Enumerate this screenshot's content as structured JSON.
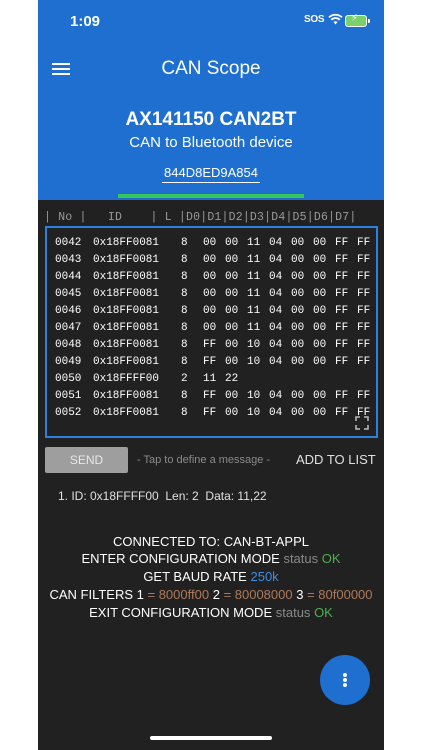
{
  "status_bar": {
    "time": "1:09",
    "sos": "SOS"
  },
  "app_bar": {
    "title": "CAN Scope"
  },
  "device": {
    "name": "AX141150 CAN2BT",
    "subtitle": "CAN to Bluetooth device",
    "mac": "844D8ED9A854"
  },
  "table": {
    "header": "| No |   ID    | L |D0|D1|D2|D3|D4|D5|D6|D7|",
    "rows": [
      {
        "no": "0042",
        "id": "0x18FF0081",
        "len": "8",
        "data": [
          "00",
          "00",
          "11",
          "04",
          "00",
          "00",
          "FF",
          "FF"
        ]
      },
      {
        "no": "0043",
        "id": "0x18FF0081",
        "len": "8",
        "data": [
          "00",
          "00",
          "11",
          "04",
          "00",
          "00",
          "FF",
          "FF"
        ]
      },
      {
        "no": "0044",
        "id": "0x18FF0081",
        "len": "8",
        "data": [
          "00",
          "00",
          "11",
          "04",
          "00",
          "00",
          "FF",
          "FF"
        ]
      },
      {
        "no": "0045",
        "id": "0x18FF0081",
        "len": "8",
        "data": [
          "00",
          "00",
          "11",
          "04",
          "00",
          "00",
          "FF",
          "FF"
        ]
      },
      {
        "no": "0046",
        "id": "0x18FF0081",
        "len": "8",
        "data": [
          "00",
          "00",
          "11",
          "04",
          "00",
          "00",
          "FF",
          "FF"
        ]
      },
      {
        "no": "0047",
        "id": "0x18FF0081",
        "len": "8",
        "data": [
          "00",
          "00",
          "11",
          "04",
          "00",
          "00",
          "FF",
          "FF"
        ]
      },
      {
        "no": "0048",
        "id": "0x18FF0081",
        "len": "8",
        "data": [
          "FF",
          "00",
          "10",
          "04",
          "00",
          "00",
          "FF",
          "FF"
        ]
      },
      {
        "no": "0049",
        "id": "0x18FF0081",
        "len": "8",
        "data": [
          "FF",
          "00",
          "10",
          "04",
          "00",
          "00",
          "FF",
          "FF"
        ]
      },
      {
        "no": "0050",
        "id": "0x18FFFF00",
        "len": "2",
        "data": [
          "11",
          "22",
          "",
          "",
          "",
          "",
          "",
          ""
        ]
      },
      {
        "no": "0051",
        "id": "0x18FF0081",
        "len": "8",
        "data": [
          "FF",
          "00",
          "10",
          "04",
          "00",
          "00",
          "FF",
          "FF"
        ]
      },
      {
        "no": "0052",
        "id": "0x18FF0081",
        "len": "8",
        "data": [
          "FF",
          "00",
          "10",
          "04",
          "00",
          "00",
          "FF",
          "FF"
        ]
      }
    ]
  },
  "send": {
    "button_label": "SEND",
    "hint": "- Tap to define a message -",
    "add_label": "ADD TO LIST",
    "queued_message": "1. ID: 0x18FFFF00  Len: 2  Data: 11,22"
  },
  "log": {
    "connected": "CONNECTED TO: CAN-BT-APPL",
    "enter_config": "ENTER CONFIGURATION MODE",
    "status_word": "status",
    "ok": "OK",
    "get_baud": "GET BAUD RATE",
    "baud_value": "250k",
    "filters_label": "CAN FILTERS",
    "filter1_num": "1",
    "filter1_val": "= 8000ff00",
    "filter2_num": "2",
    "filter2_val": "= 80008000",
    "filter3_num": "3",
    "filter3_val": "= 80f00000",
    "exit_config": "EXIT CONFIGURATION MODE"
  },
  "colors": {
    "primary": "#1e6fd0",
    "background": "#212121",
    "ok": "#4caf50",
    "accent_tab": "#34c759"
  },
  "icons": {
    "menu": "hamburger-icon",
    "fab": "more-vertical-icon",
    "expand": "expand-icon"
  }
}
